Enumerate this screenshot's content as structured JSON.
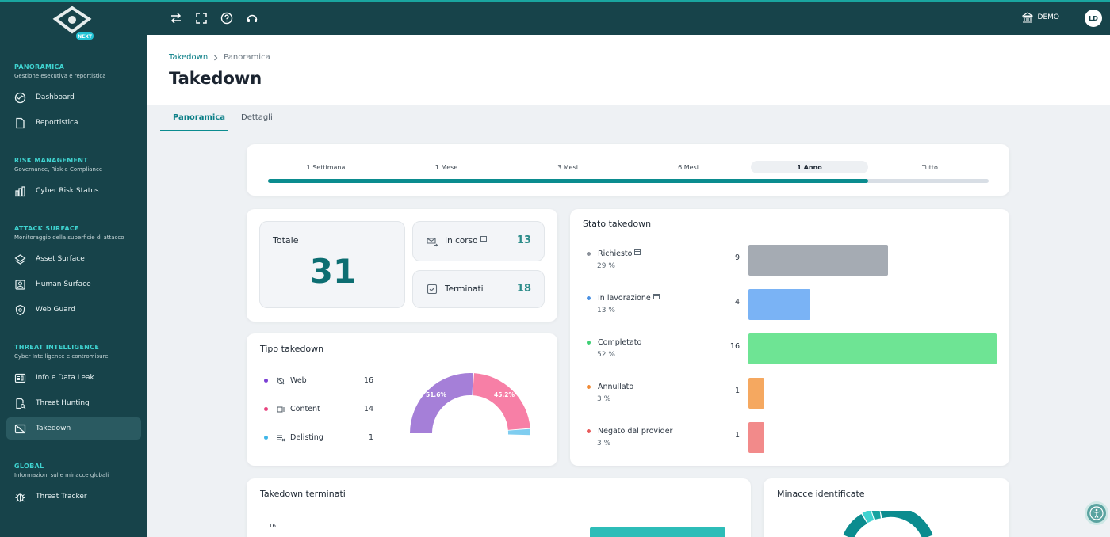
{
  "app": {
    "account": "DEMO",
    "user_initials": "LD"
  },
  "sidebar": {
    "sections": [
      {
        "title": "PANORAMICA",
        "subtitle": "Gestione esecutiva e reportistica",
        "items": [
          {
            "label": "Dashboard",
            "icon": "globe-icon"
          },
          {
            "label": "Reportistica",
            "icon": "document-icon"
          }
        ]
      },
      {
        "title": "RISK MANAGEMENT",
        "subtitle": "Governance, Risk e Compliance",
        "items": [
          {
            "label": "Cyber Risk Status",
            "icon": "bar-chart-icon"
          }
        ]
      },
      {
        "title": "ATTACK SURFACE",
        "subtitle": "Monitoraggio della superficie di attacco",
        "items": [
          {
            "label": "Asset Surface",
            "icon": "layers-icon"
          },
          {
            "label": "Human Surface",
            "icon": "person-badge-icon"
          },
          {
            "label": "Web Guard",
            "icon": "shield-icon"
          }
        ]
      },
      {
        "title": "THREAT INTELLIGENCE",
        "subtitle": "Cyber Intelligence e contromisure",
        "items": [
          {
            "label": "Info e Data Leak",
            "icon": "id-card-icon"
          },
          {
            "label": "Threat Hunting",
            "icon": "doc-search-icon"
          },
          {
            "label": "Takedown",
            "icon": "takedown-icon"
          }
        ]
      },
      {
        "title": "GLOBAL",
        "subtitle": "Informazioni sulle minacce globali",
        "items": [
          {
            "label": "Threat Tracker",
            "icon": "bug-icon"
          }
        ]
      }
    ],
    "active_item": "Takedown"
  },
  "breadcrumb": {
    "root": "Takedown",
    "current": "Panoramica"
  },
  "page_title": "Takedown",
  "tabs": [
    {
      "label": "Panoramica",
      "active": true
    },
    {
      "label": "Dettagli",
      "active": false
    }
  ],
  "periods": [
    "1 Settimana",
    "1 Mese",
    "3 Mesi",
    "6 Mesi",
    "1 Anno",
    "Tutto"
  ],
  "active_period": "1 Anno",
  "summary": {
    "total_label": "Totale",
    "total": "31",
    "in_progress_label": "In corso",
    "in_progress": "13",
    "done_label": "Terminati",
    "done": "18"
  },
  "colors": {
    "accent": "#0b8c8f",
    "sidebar": "#17434a"
  },
  "tipo": {
    "title": "Tipo takedown",
    "items": [
      {
        "label": "Web",
        "value": "16",
        "color": "#7b3fd4",
        "icon": "web-off-icon"
      },
      {
        "label": "Content",
        "value": "14",
        "color": "#e8427e",
        "icon": "content-icon"
      },
      {
        "label": "Delisting",
        "value": "1",
        "color": "#3fb6e8",
        "icon": "delisting-icon"
      }
    ],
    "slice_labels": {
      "web": "51.6%",
      "content": "45.2%"
    }
  },
  "stato": {
    "title": "Stato takedown",
    "items": [
      {
        "label": "Richiesto",
        "pct": "29 %",
        "count": "9",
        "color": "#a5abb3",
        "dot": "#8a9099"
      },
      {
        "label": "In lavorazione",
        "pct": "13 %",
        "count": "4",
        "color": "#7ab3f5",
        "dot": "#4a90e2"
      },
      {
        "label": "Completato",
        "pct": "52 %",
        "count": "16",
        "color": "#6ee494",
        "dot": "#3ecf74"
      },
      {
        "label": "Annullato",
        "pct": "3 %",
        "count": "1",
        "color": "#f5a860",
        "dot": "#f08a35"
      },
      {
        "label": "Negato dal provider",
        "pct": "3 %",
        "count": "1",
        "color": "#f28a8a",
        "dot": "#e85a5a"
      }
    ]
  },
  "chart_data": [
    {
      "type": "pie",
      "title": "Tipo takedown",
      "categories": [
        "Web",
        "Content",
        "Delisting"
      ],
      "values": [
        16,
        14,
        1
      ]
    },
    {
      "type": "bar",
      "title": "Stato takedown",
      "categories": [
        "Richiesto",
        "In lavorazione",
        "Completato",
        "Annullato",
        "Negato dal provider"
      ],
      "values": [
        9,
        4,
        16,
        1,
        1
      ]
    }
  ],
  "terminati": {
    "title": "Takedown terminati",
    "y_tick": "16"
  },
  "minacce": {
    "title": "Minacce identificate"
  }
}
